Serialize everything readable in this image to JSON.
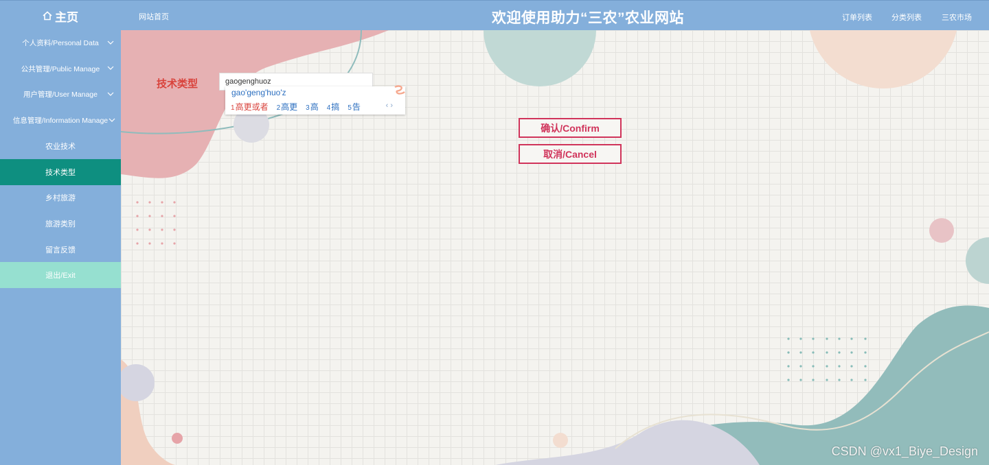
{
  "topbar": {
    "home_label": "主页",
    "site_home": "网站首页",
    "title": "欢迎使用助力“三农”农业网站",
    "links": [
      "订单列表",
      "分类列表",
      "三农市场"
    ]
  },
  "sidebar": {
    "items": [
      {
        "label": "个人资料/Personal Data"
      },
      {
        "label": "公共管理/Public Manage"
      },
      {
        "label": "用户管理/User Manage"
      },
      {
        "label": "信息管理/Information Manage"
      },
      {
        "label": "农业技术"
      },
      {
        "label": "技术类型"
      },
      {
        "label": "乡村旅游"
      },
      {
        "label": "旅游类别"
      },
      {
        "label": "留言反馈"
      },
      {
        "label": "退出/Exit"
      }
    ]
  },
  "form": {
    "field_label": "技术类型",
    "input_value": "gaogenghuoz",
    "ime": {
      "pinyin": "gao'geng'huo'z",
      "candidates": [
        {
          "num": "1",
          "text": "高更或者"
        },
        {
          "num": "2",
          "text": "高更"
        },
        {
          "num": "3",
          "text": "高"
        },
        {
          "num": "4",
          "text": "搞"
        },
        {
          "num": "5",
          "text": "告"
        }
      ],
      "nav": "‹ ›"
    },
    "confirm_label": "确认/Confirm",
    "cancel_label": "取消/Cancel"
  },
  "watermark": "CSDN @vx1_Biye_Design",
  "colors": {
    "topbar": "#84afdb",
    "sidebar": "#84afdb",
    "active_item": "#0e8f80",
    "logout_item": "#96e0d0",
    "accent_red": "#d0335a"
  }
}
